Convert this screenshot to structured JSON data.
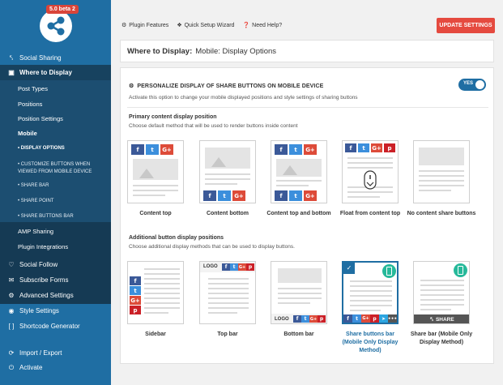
{
  "badge": "5.0 beta 2",
  "sidebar": {
    "items": [
      {
        "label": "Social Sharing",
        "icon": "share-icon"
      },
      {
        "label": "Where to Display",
        "icon": "monitor-icon"
      },
      {
        "label": "Social Follow",
        "icon": "heart-icon"
      },
      {
        "label": "Subscribe Forms",
        "icon": "envelope-icon"
      },
      {
        "label": "Advanced Settings",
        "icon": "gear-icon"
      },
      {
        "label": "Style Settings",
        "icon": "palette-icon"
      },
      {
        "label": "Shortcode Generator",
        "icon": "code-icon"
      },
      {
        "label": "Import / Export",
        "icon": "refresh-icon"
      },
      {
        "label": "Activate",
        "icon": "power-icon"
      }
    ],
    "submenu": [
      "Post Types",
      "Positions",
      "Position Settings",
      "Mobile",
      "AMP Sharing",
      "Plugin Integrations"
    ],
    "subsub": [
      "• DISPLAY OPTIONS",
      "• CUSTOMIZE BUTTONS WHEN VIEWED FROM MOBILE DEVICE",
      "• SHARE BAR",
      "• SHARE POINT",
      "• SHARE BUTTONS BAR"
    ]
  },
  "toplinks": [
    "Plugin Features",
    "Quick Setup Wizard",
    "Need Help?"
  ],
  "update_label": "UPDATE SETTINGS",
  "header": {
    "prefix": "Where to Display:",
    "title": "Mobile: Display Options"
  },
  "section": {
    "title": "PERSONALIZE DISPLAY OF SHARE BUTTONS ON MOBILE DEVICE",
    "desc": "Activate this option to change your mobile displayed positions and style settings of sharing buttons",
    "toggle": "YES"
  },
  "primary": {
    "title": "Primary content display position",
    "desc": "Choose default method that will be used to render buttons inside content",
    "options": [
      "Content top",
      "Content bottom",
      "Content top and bottom",
      "Float from content top",
      "No content share buttons"
    ]
  },
  "additional": {
    "title": "Additional button display positions",
    "desc": "Choose additional display methods that can be used to display buttons.",
    "options": [
      "Sidebar",
      "Top bar",
      "Bottom bar",
      "Share buttons bar (Mobile Only Display Method)",
      "Share bar (Mobile Only Display Method)"
    ]
  },
  "logo_text": "LOGO",
  "share_text": "SHARE",
  "colors": {
    "sidebar": "#1f6ea3",
    "accent": "#e54a3f",
    "facebook": "#3b5998",
    "twitter": "#3c8fdc",
    "google": "#dd4b39",
    "pinterest": "#cb2027",
    "mobile": "#26b99a"
  }
}
